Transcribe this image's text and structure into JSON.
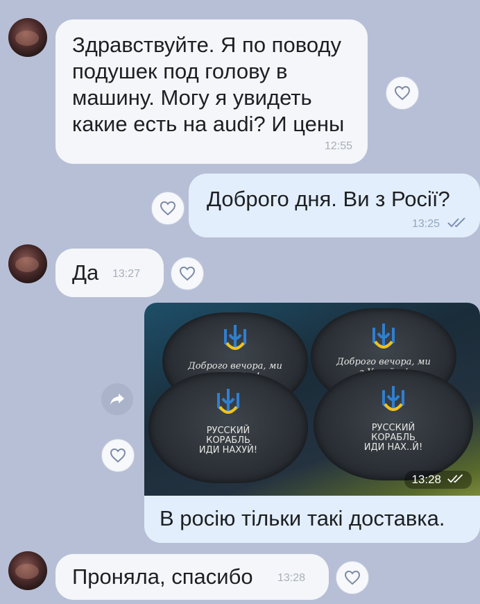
{
  "messages": [
    {
      "id": "m1",
      "direction": "incoming",
      "text": "Здравствуйте. Я по поводу подушек под голову в машину. Могу я увидеть какие есть на audi? И цены",
      "time": "12:55"
    },
    {
      "id": "m2",
      "direction": "outgoing",
      "text": "Доброго дня. Ви з Росії?",
      "time": "13:25",
      "status": "read"
    },
    {
      "id": "m3",
      "direction": "incoming",
      "text": "Да",
      "time": "13:27"
    },
    {
      "id": "m4",
      "direction": "outgoing",
      "type": "photo",
      "caption": "В росію тільки такі доставка.",
      "time": "13:28",
      "status": "read",
      "photo_text": {
        "top_left": "Доброго вечора, ми з України!",
        "top_right": "Доброго вечора, ми з України!",
        "bottom_left": [
          "РУССКИЙ",
          "КОРАБЛЬ",
          "ИДИ НАХУЙ!"
        ],
        "bottom_right": [
          "РУССКИЙ",
          "КОРАБЛЬ",
          "ИДИ НАХ..Й!"
        ]
      }
    },
    {
      "id": "m5",
      "direction": "incoming",
      "text": "Проняла, спасибо",
      "time": "13:28"
    }
  ],
  "icons": {
    "reaction": "heart-outline-icon",
    "share": "share-arrow-icon",
    "read": "double-check-icon",
    "avatar": "contact-avatar"
  },
  "colors": {
    "background": "#b7bfd6",
    "incoming_bubble": "#f4f6f9",
    "outgoing_bubble": "#e2eefb",
    "read_check": "#7c8fb3"
  }
}
